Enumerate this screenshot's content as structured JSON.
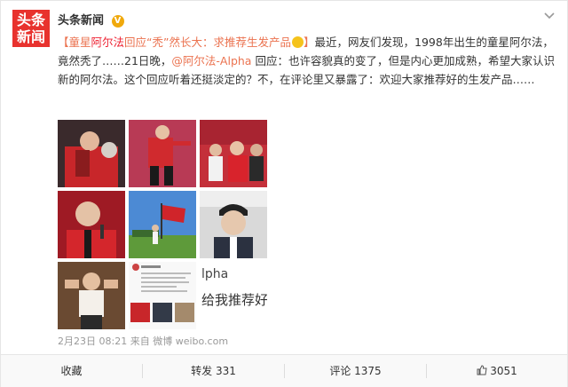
{
  "author": {
    "avatar_line1": "头条",
    "avatar_line2": "新闻",
    "name": "头条新闻"
  },
  "post": {
    "tag_open": "【",
    "title_a": "童星",
    "title_name": "阿尔法",
    "title_b": "回应“秃”然长大：求推荐生发产品",
    "tag_close": "】",
    "body_1": "最近，网友们发现，1998年出生的童星阿尔法，竟然秃了……21日晚，",
    "mention": "@阿尔法-Alpha",
    "body_2": " 回应：也许容貌真的变了，但是内心更加成熟，希望大家认识新的阿尔法。这个回应听着还挺淡定的？不，在评论里又暴露了：欢迎大家推荐好的生发产品……"
  },
  "screenshot_text": {
    "line1": "lpha",
    "line2": "给我推荐好"
  },
  "meta": {
    "time": "2月23日 08:21",
    "via": "来自",
    "source": "微博 weibo.com"
  },
  "actions": {
    "fav": "收藏",
    "repost": "转发 331",
    "comment": "评论 1375",
    "like": "3051"
  },
  "icons": [
    "verified-icon",
    "chevron-down-icon",
    "like-icon"
  ],
  "colors": {
    "accent": "#eb7350",
    "avatar_bg": "#e8322e",
    "verified": "#f0a90c"
  }
}
